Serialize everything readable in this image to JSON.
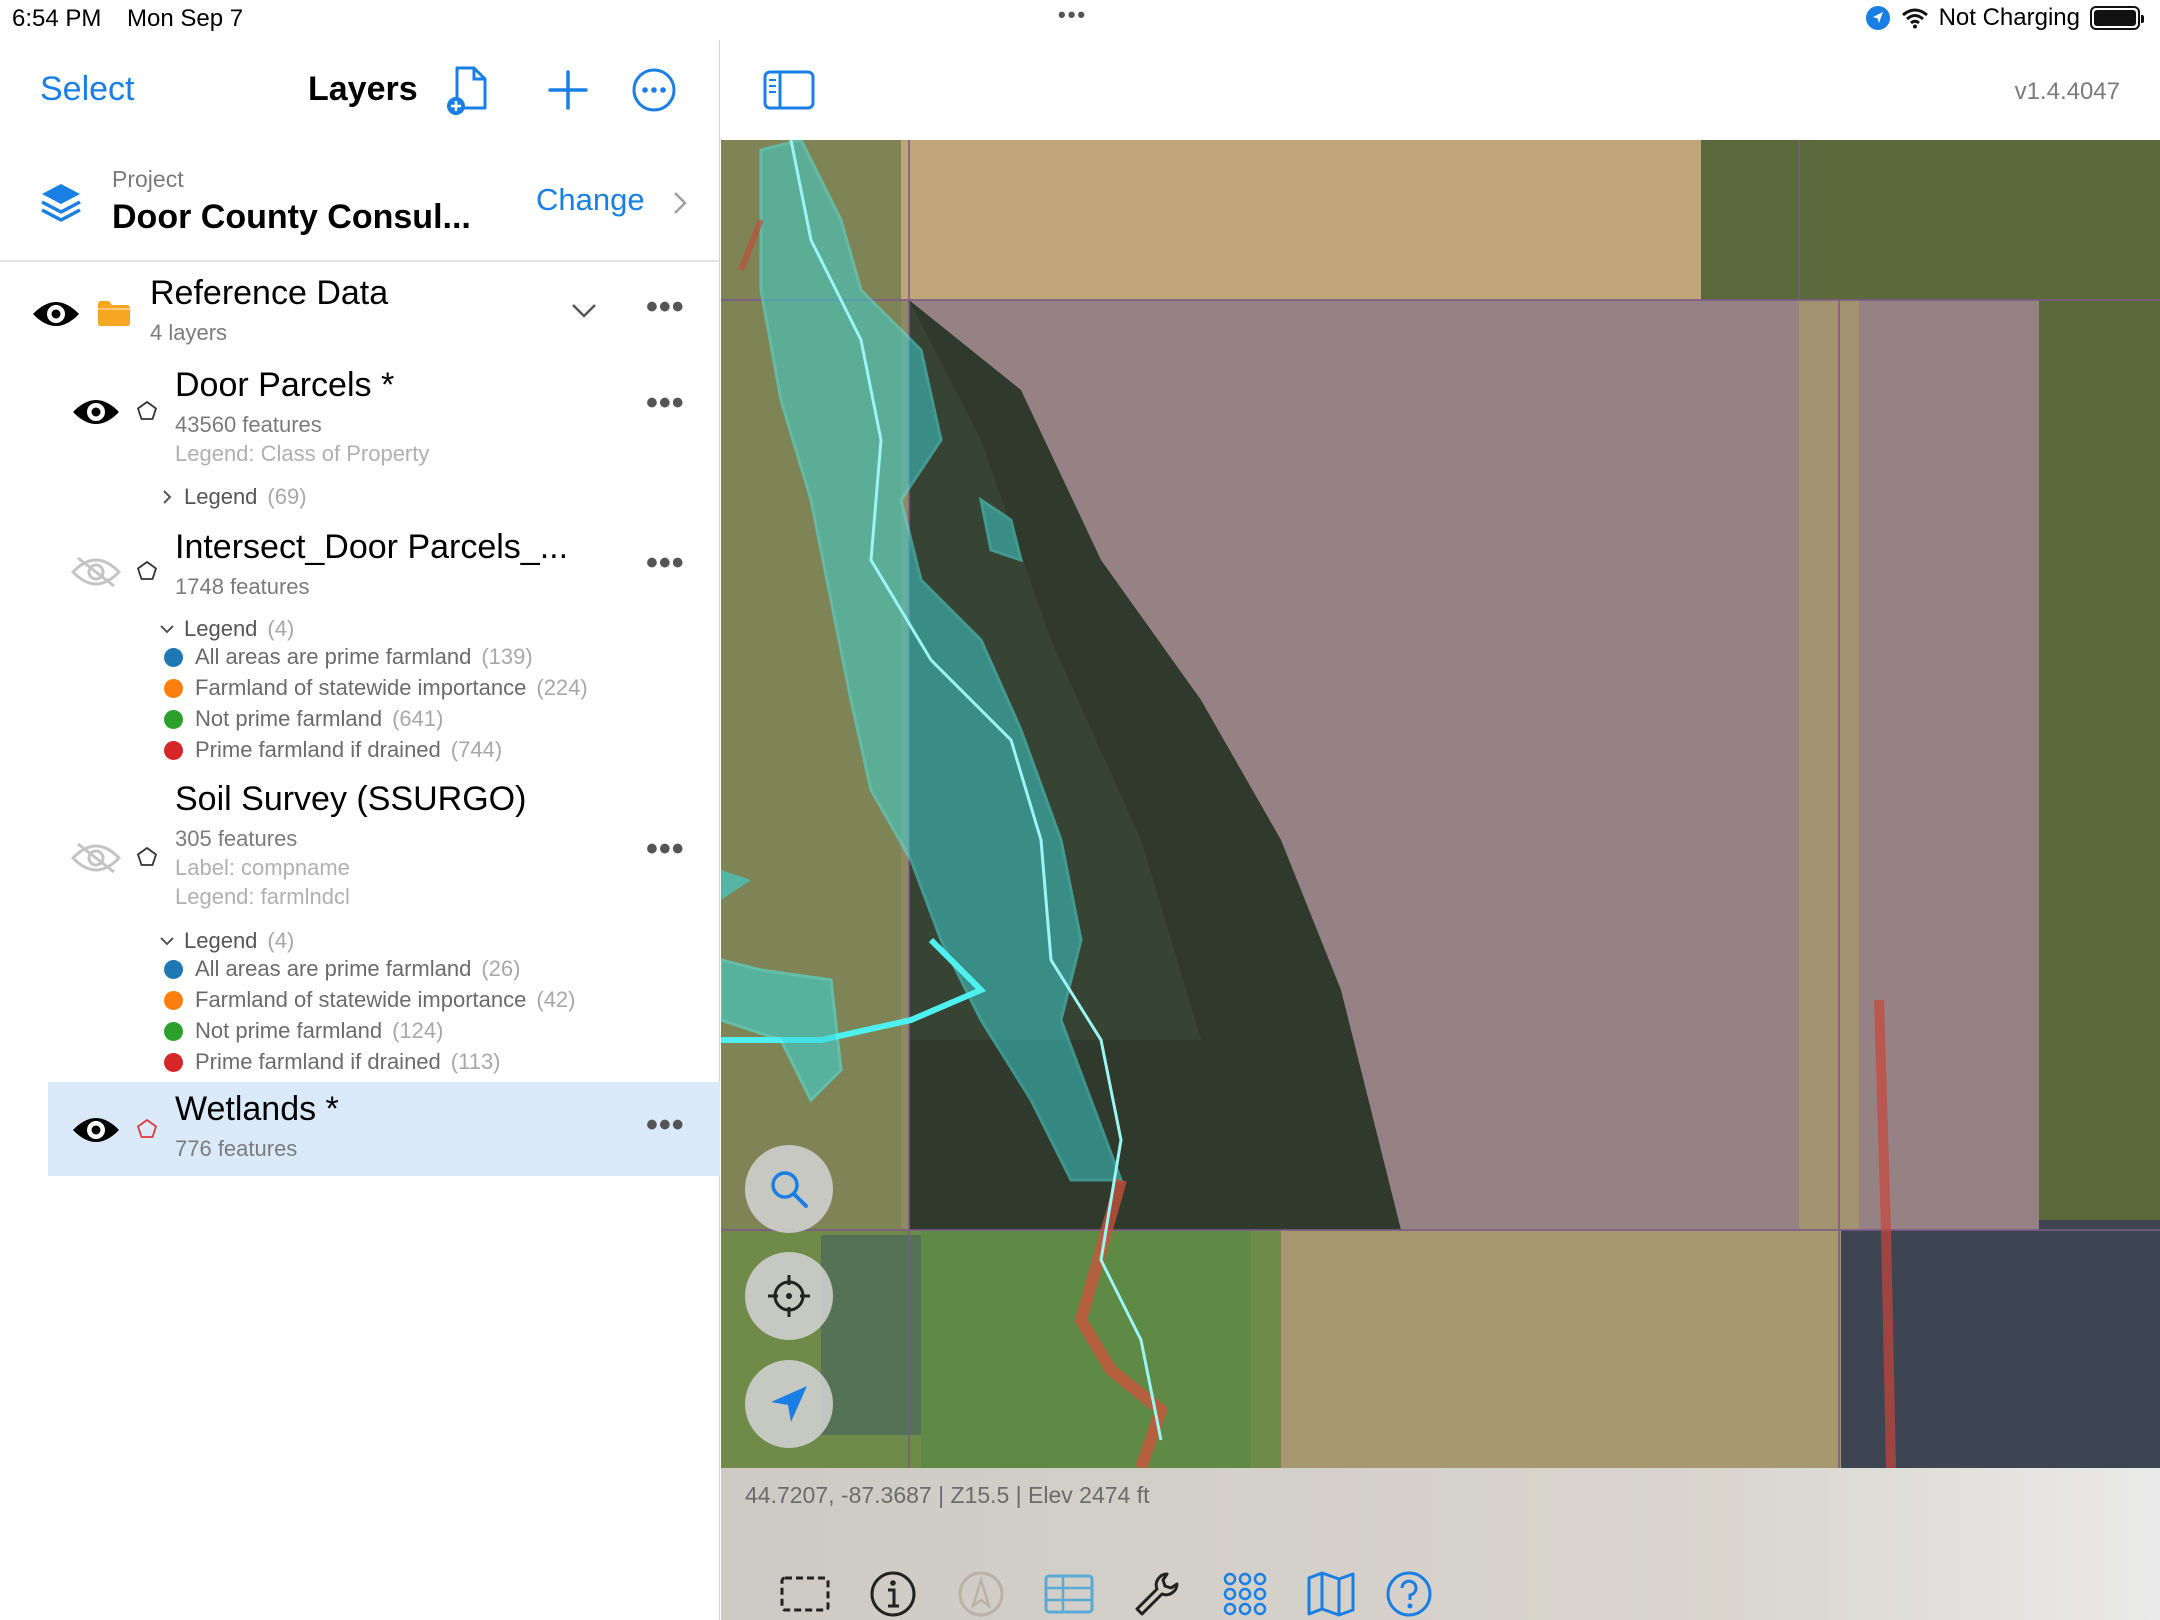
{
  "status_bar": {
    "time": "6:54 PM",
    "date": "Mon Sep 7",
    "battery_text": "Not Charging"
  },
  "nav": {
    "select_label": "Select",
    "title": "Layers"
  },
  "project": {
    "label": "Project",
    "name": "Door County Consul...",
    "change_label": "Change"
  },
  "group": {
    "name": "Reference Data",
    "count": "4 layers"
  },
  "layers": [
    {
      "name": "Door Parcels *",
      "features": "43560 features",
      "meta": [
        "Legend: Class of Property"
      ],
      "legend_label": "Legend",
      "legend_count": "(69)",
      "legend_items": []
    },
    {
      "name": "Intersect_Door Parcels_...",
      "features": "1748 features",
      "meta": [],
      "legend_label": "Legend",
      "legend_count": "(4)",
      "legend_items": [
        {
          "label": "All areas are prime farmland",
          "count": "(139)",
          "color": "#1f77b4"
        },
        {
          "label": "Farmland of statewide importance",
          "count": "(224)",
          "color": "#ff7f0e"
        },
        {
          "label": "Not prime farmland",
          "count": "(641)",
          "color": "#2ca02c"
        },
        {
          "label": "Prime farmland if drained",
          "count": "(744)",
          "color": "#d62728"
        }
      ]
    },
    {
      "name": "Soil Survey (SSURGO)",
      "features": "305 features",
      "meta": [
        "Label: compname",
        "Legend: farmlndcl"
      ],
      "legend_label": "Legend",
      "legend_count": "(4)",
      "legend_items": [
        {
          "label": "All areas are prime farmland",
          "count": "(26)",
          "color": "#1f77b4"
        },
        {
          "label": "Farmland of statewide importance",
          "count": "(42)",
          "color": "#ff7f0e"
        },
        {
          "label": "Not prime farmland",
          "count": "(124)",
          "color": "#2ca02c"
        },
        {
          "label": "Prime farmland if drained",
          "count": "(113)",
          "color": "#d62728"
        }
      ]
    },
    {
      "name": "Wetlands *",
      "features": "776 features",
      "meta": [],
      "legend_items": []
    }
  ],
  "map": {
    "version": "v1.4.4047",
    "coords": "44.7207, -87.3687 | Z15.5 | Elev 2474 ft"
  },
  "colors": {
    "accent": "#1a7fe5",
    "selected_row": "#dbeafb",
    "wetland_fill": "#3ad6d6",
    "parcel_tint": "#8a7aa8"
  }
}
